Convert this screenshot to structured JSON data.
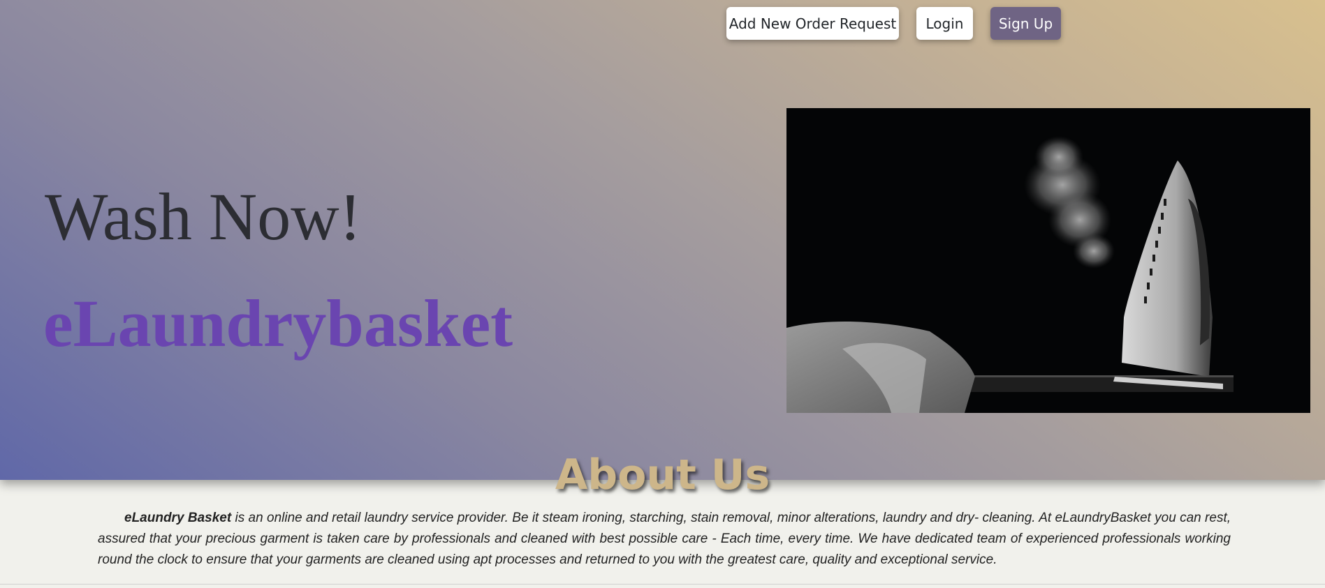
{
  "nav": {
    "add_order": "Add New Order Request",
    "login": "Login",
    "signup": "Sign Up"
  },
  "hero": {
    "headline": "Wash Now!",
    "brand": "eLaundrybasket",
    "image_icon": "steam-iron-photo"
  },
  "about": {
    "title": "About Us",
    "brand_name": "eLaundry Basket",
    "body": " is an online and retail laundry service provider. Be it steam ironing, starching, stain removal, minor alterations, laundry and dry- cleaning. At eLaundryBasket you can rest, assured that your precious garment is taken care by professionals and cleaned with best possible care - Each time, every time. We have dedicated team of experienced professionals working round the clock to ensure that your garments are cleaned using apt processes and returned to you with the greatest care, quality and exceptional service."
  },
  "colors": {
    "brand_purple": "#6a45b0",
    "signup_bg": "#6f6484",
    "about_gold": "#cdb68a"
  }
}
